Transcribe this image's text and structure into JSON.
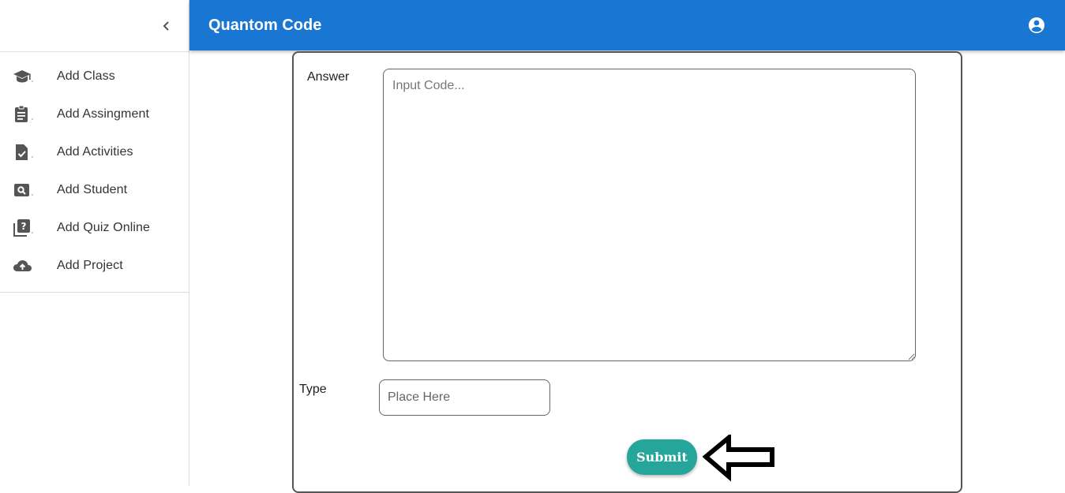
{
  "header": {
    "title": "Quantom Code",
    "account_icon": "account-circle-icon",
    "color": "#1976d2"
  },
  "sidebar": {
    "collapse_icon": "chevron-left-icon",
    "items": [
      {
        "label": "Add Class",
        "icon": "school-icon"
      },
      {
        "label": "Add Assingment",
        "icon": "assignment-icon"
      },
      {
        "label": "Add Activities",
        "icon": "task-icon"
      },
      {
        "label": "Add Student",
        "icon": "find-in-page-icon"
      },
      {
        "label": "Add Quiz Online",
        "icon": "quiz-icon"
      },
      {
        "label": "Add Project",
        "icon": "cloud-upload-icon"
      }
    ]
  },
  "form": {
    "answer_label": "Answer",
    "answer_placeholder": "Input Code...",
    "type_label": "Type",
    "type_placeholder": "Place Here",
    "submit_label": "Submit",
    "submit_color": "#26a69a"
  },
  "annotation": {
    "icon": "arrow-left-outline-icon"
  }
}
